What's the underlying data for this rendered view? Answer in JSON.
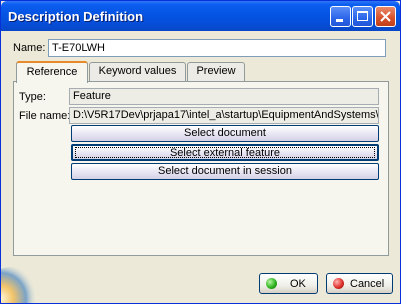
{
  "window": {
    "title": "Description Definition"
  },
  "titlebar": {
    "minimize_icon": "minimize-icon",
    "maximize_icon": "maximize-icon",
    "close_icon": "close-icon",
    "close_color": "#d6502a",
    "accent": "#0554e3"
  },
  "name": {
    "label": "Name:",
    "value": "T-E70LWH"
  },
  "tabs": [
    {
      "label": "Reference",
      "active": true
    },
    {
      "label": "Keyword values",
      "active": false
    },
    {
      "label": "Preview",
      "active": false
    }
  ],
  "reference": {
    "type_label": "Type:",
    "type_value": "Feature",
    "file_label": "File name:",
    "file_value": "D:\\V5R17Dev\\prjapa17\\intel_a\\startup\\EquipmentAndSystems\\",
    "buttons": [
      {
        "label": "Select document",
        "focused": false
      },
      {
        "label": "Select external feature",
        "focused": true
      },
      {
        "label": "Select document in session",
        "focused": false
      }
    ]
  },
  "footer": {
    "ok_label": "OK",
    "cancel_label": "Cancel",
    "ok_icon": "green-circle-icon",
    "cancel_icon": "red-circle-icon",
    "ok_color": "#2fb51f",
    "cancel_color": "#e0302b"
  }
}
